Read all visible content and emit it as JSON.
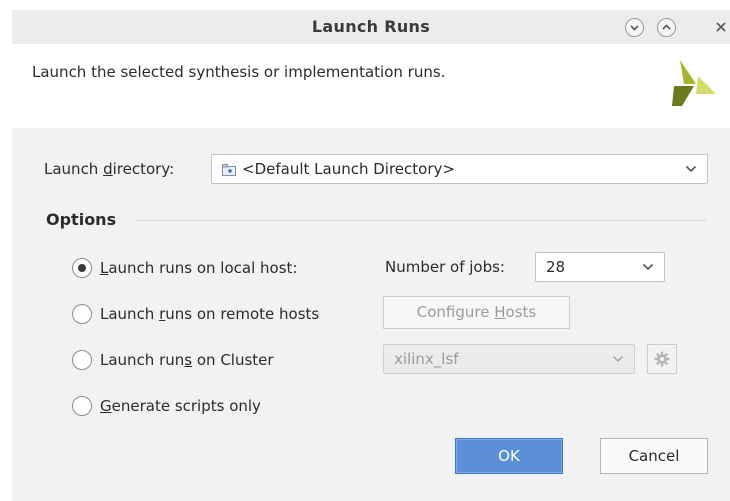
{
  "window": {
    "title": "Launch Runs",
    "controls": [
      "chevron-down-icon",
      "chevron-up-icon",
      "close-icon"
    ]
  },
  "header": {
    "description": "Launch the selected synthesis or implementation runs.",
    "logo_icon": "vivado-logo",
    "logo_colors": [
      "#6b7a1a",
      "#a8b52a",
      "#d4dc6a"
    ]
  },
  "launch_directory": {
    "label_pre": "Launch ",
    "label_mnemonic": "d",
    "label_post": "irectory:",
    "value": "<Default Launch Directory>",
    "icon": "folder-icon"
  },
  "options": {
    "title": "Options",
    "local": {
      "label_pre": "",
      "label_mnemonic": "L",
      "label_post": "aunch runs on local host:",
      "checked": true,
      "jobs_label": "Number of jobs:",
      "jobs_value": "28"
    },
    "remote": {
      "label_pre": "Launch ",
      "label_mnemonic": "r",
      "label_post": "uns on remote hosts",
      "checked": false,
      "configure_pre": "Configure ",
      "configure_mnemonic": "H",
      "configure_post": "osts"
    },
    "cluster": {
      "label_pre": "Launch run",
      "label_mnemonic": "s",
      "label_post": " on Cluster",
      "checked": false,
      "cluster_value": "xilinx_lsf",
      "gear_icon": "gear-icon"
    },
    "scripts": {
      "label_pre": "",
      "label_mnemonic": "G",
      "label_post": "enerate scripts only",
      "checked": false
    }
  },
  "footer": {
    "ok_label": "OK",
    "cancel_label": "Cancel"
  },
  "colors": {
    "accent": "#5b8fd8",
    "titlebar": "#ececec",
    "body": "#f2f2f2"
  }
}
